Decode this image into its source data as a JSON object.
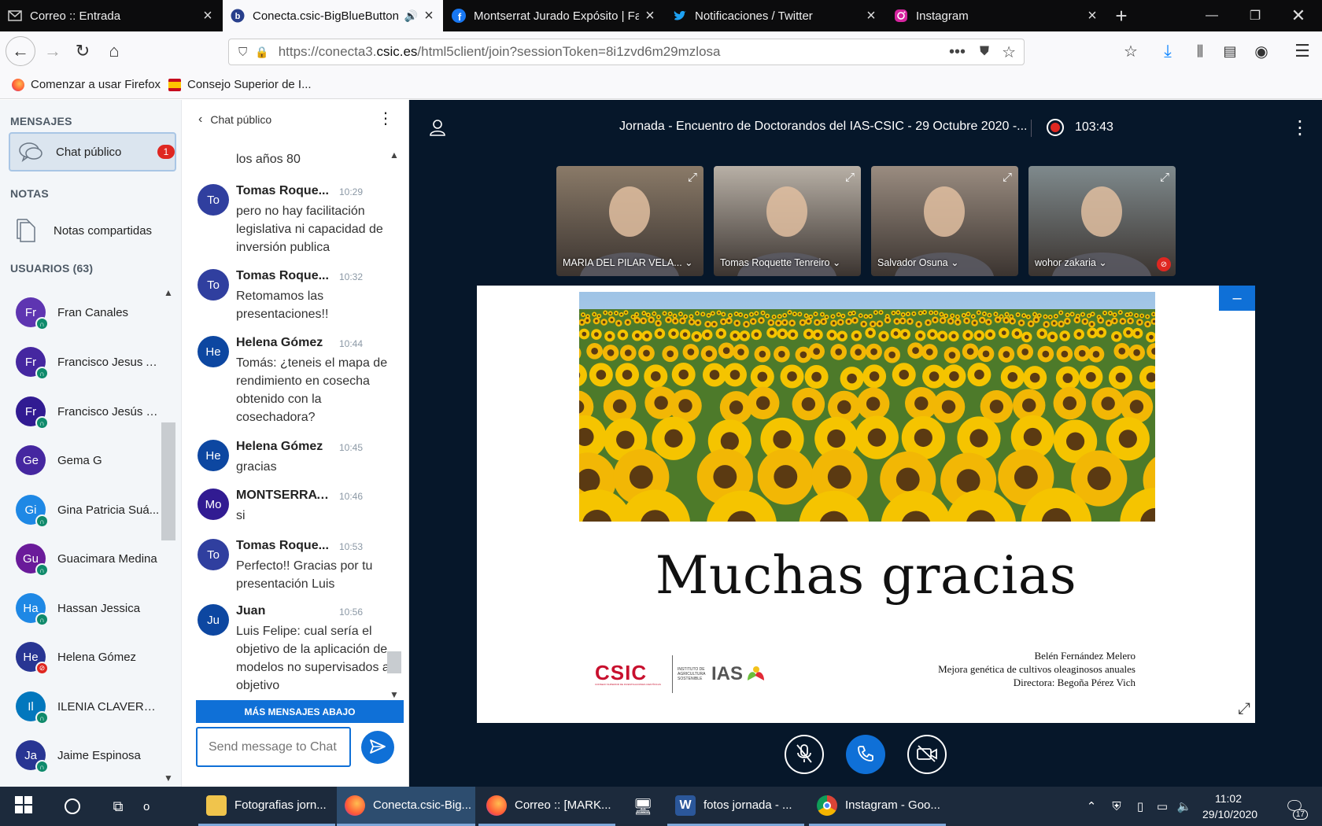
{
  "browser": {
    "tabs": [
      {
        "title": "Correo :: Entrada",
        "icon": "mail-icon"
      },
      {
        "title": "Conecta.csic-BigBlueButton",
        "icon": "bigbluebutton-icon"
      },
      {
        "title": "Montserrat Jurado Expósito | Fa",
        "icon": "facebook-icon"
      },
      {
        "title": "Notificaciones / Twitter",
        "icon": "twitter-icon"
      },
      {
        "title": "Instagram",
        "icon": "instagram-icon"
      }
    ],
    "url_prefix": "https://conecta3.",
    "url_domain": "csic.es",
    "url_path": "/html5client/join?sessionToken=8i1zvd6m29mzlosa",
    "bookmarks": [
      "Comenzar a usar Firefox",
      "Consejo Superior de I..."
    ]
  },
  "left_panel": {
    "messages_heading": "MENSAJES",
    "public_chat_label": "Chat público",
    "unread_count": "1",
    "notes_heading": "NOTAS",
    "shared_notes_label": "Notas compartidas",
    "users_heading": "USUARIOS (63)",
    "users": [
      {
        "initials": "Fr",
        "name": "Fran Canales",
        "color": "#5e35b1",
        "status": "listen"
      },
      {
        "initials": "Fr",
        "name": "Francisco Jesus A...",
        "color": "#4527a0",
        "status": "listen"
      },
      {
        "initials": "Fr",
        "name": "Francisco Jesús G...",
        "color": "#311b92",
        "status": "listen"
      },
      {
        "initials": "Ge",
        "name": "Gema G",
        "color": "#4527a0",
        "status": "none"
      },
      {
        "initials": "Gi",
        "name": "Gina Patricia Suá...",
        "color": "#1e88e5",
        "status": "listen"
      },
      {
        "initials": "Gu",
        "name": "Guacimara Medina",
        "color": "#6a1b9a",
        "status": "listen"
      },
      {
        "initials": "Ha",
        "name": "Hassan Jessica",
        "color": "#1e88e5",
        "status": "listen"
      },
      {
        "initials": "He",
        "name": "Helena Gómez",
        "color": "#283593",
        "status": "muted"
      },
      {
        "initials": "Il",
        "name": "ILENIA CLAVERO ...",
        "color": "#0277bd",
        "status": "listen"
      },
      {
        "initials": "Ja",
        "name": "Jaime Espinosa",
        "color": "#283593",
        "status": "listen"
      }
    ]
  },
  "chat": {
    "header": "Chat público",
    "first_text": "los años 80",
    "messages": [
      {
        "initials": "To",
        "name": "Tomas Roque...",
        "time": "10:29",
        "text": "pero no hay facilitación legislativa ni capacidad de inversión publica",
        "color": "#303f9f"
      },
      {
        "initials": "To",
        "name": "Tomas Roque...",
        "time": "10:32",
        "text": "Retomamos las presentaciones!!",
        "color": "#303f9f"
      },
      {
        "initials": "He",
        "name": "Helena Gómez",
        "time": "10:44",
        "text": "Tomás: ¿teneis el mapa de rendimiento en cosecha obtenido con la cosechadora?",
        "color": "#0d47a1"
      },
      {
        "initials": "He",
        "name": "Helena Gómez",
        "time": "10:45",
        "text": "gracias",
        "color": "#0d47a1"
      },
      {
        "initials": "Mo",
        "name": "MONTSERRAT...",
        "time": "10:46",
        "text": "si",
        "color": "#311b92"
      },
      {
        "initials": "To",
        "name": "Tomas Roque...",
        "time": "10:53",
        "text": "Perfecto!! Gracias por tu presentación Luis",
        "color": "#303f9f"
      },
      {
        "initials": "Ju",
        "name": "Juan",
        "time": "10:56",
        "text": "Luis Felipe: cual sería el objetivo de la aplicación de modelos no supervisados al objetivo",
        "color": "#0d47a1"
      }
    ],
    "more_below": "MÁS MENSAJES ABAJO",
    "input_placeholder": "Send message to Chat"
  },
  "meeting": {
    "title": "Jornada - Encuentro de Doctorandos del IAS-CSIC - 29 Octubre 2020 -...",
    "record_time": "103:43",
    "cams": [
      {
        "name": "MARIA DEL PILAR VELA...",
        "bg": "#8a7a68"
      },
      {
        "name": "Tomas Roquette Tenreiro",
        "bg": "#b8b0a6"
      },
      {
        "name": "Salvador Osuna",
        "bg": "#9a8c80"
      },
      {
        "name": "wohor zakaria",
        "bg": "#7f8a8d"
      }
    ],
    "slide": {
      "heading": "Muchas gracias",
      "credits": [
        "Belén Fernández Melero",
        "Mejora genética de cultivos oleaginosos anuales",
        "Directora:  Begoña Pérez Vich"
      ],
      "csic_logo_text": "CSIC",
      "csic_logo_sub": "CONSEJO SUPERIOR DE INVESTIGACIONES CIENTÍFICAS",
      "ias_logo_sub": "INSTITUTO DE AGRICULTURA SOSTENIBLE",
      "ias_logo_text": "IAS"
    }
  },
  "taskbar": {
    "items": [
      "o",
      "Fotografias jorn...",
      "Conecta.csic-Big...",
      "Correo :: [MARK...",
      "fotos jornada - ...",
      "Instagram - Goo..."
    ],
    "time": "11:02",
    "date": "29/10/2020",
    "notif_count": "17"
  }
}
